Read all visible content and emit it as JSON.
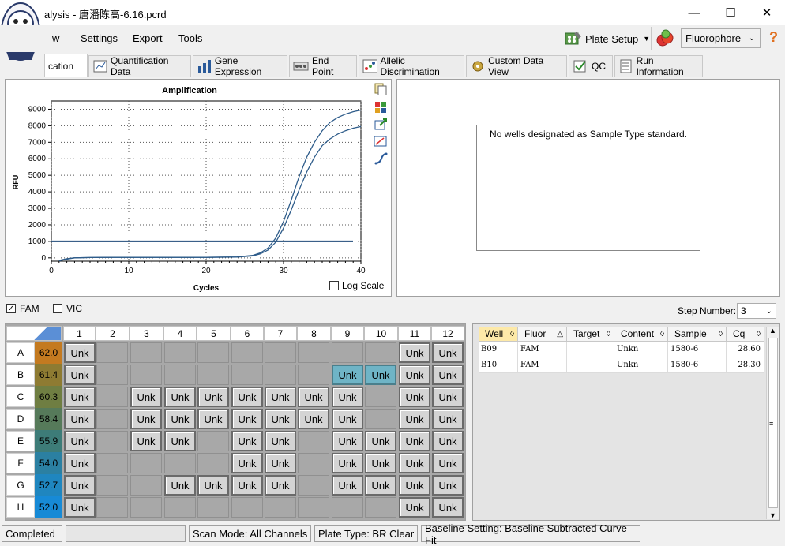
{
  "titlebar": {
    "title": "alysis - 唐潘陈高-6.16.pcrd",
    "minimize": "—",
    "maximize": "☐",
    "close": "✕"
  },
  "menu": {
    "view": "w",
    "settings": "Settings",
    "export": "Export",
    "tools": "Tools",
    "plate_setup": "Plate Setup",
    "fluorophore": "Fluorophore",
    "help": "?"
  },
  "tabs": [
    {
      "label": "cation",
      "icon": "amplification-icon"
    },
    {
      "label": "Quantification Data",
      "icon": "quantification-icon"
    },
    {
      "label": "Gene Expression",
      "icon": "bar-chart-icon"
    },
    {
      "label": "End Point",
      "icon": "endpoint-icon"
    },
    {
      "label": "Allelic Discrimination",
      "icon": "scatter-icon"
    },
    {
      "label": "Custom Data View",
      "icon": "gear-icon"
    },
    {
      "label": "QC",
      "icon": "qc-check-icon"
    },
    {
      "label": "Run Information",
      "icon": "document-icon"
    }
  ],
  "chart_data": {
    "type": "line",
    "title": "Amplification",
    "xlabel": "Cycles",
    "ylabel": "RFU",
    "xlim": [
      0,
      40
    ],
    "ylim": [
      -200,
      9500
    ],
    "xticks": [
      0,
      10,
      20,
      30,
      40
    ],
    "yticks": [
      0,
      1000,
      2000,
      3000,
      4000,
      5000,
      6000,
      7000,
      8000,
      9000
    ],
    "grid": true,
    "threshold": 1000,
    "series": [
      {
        "color": "#2e5c8a",
        "x": [
          1,
          2,
          3,
          5,
          8,
          12,
          16,
          20,
          24,
          26,
          27,
          28,
          29,
          30,
          31,
          32,
          33,
          34,
          35,
          36,
          37,
          38,
          39,
          40
        ],
        "y": [
          -150,
          -50,
          0,
          20,
          30,
          30,
          30,
          30,
          60,
          150,
          300,
          600,
          1200,
          2200,
          3500,
          4900,
          6100,
          7000,
          7700,
          8200,
          8500,
          8700,
          8850,
          8950
        ]
      },
      {
        "color": "#2e5c8a",
        "x": [
          1,
          2,
          3,
          5,
          8,
          12,
          16,
          20,
          24,
          26,
          27,
          28,
          29,
          30,
          31,
          32,
          33,
          34,
          35,
          36,
          37,
          38,
          39,
          40
        ],
        "y": [
          -180,
          -80,
          0,
          20,
          30,
          30,
          30,
          30,
          50,
          120,
          240,
          480,
          950,
          1800,
          2900,
          4100,
          5200,
          6100,
          6800,
          7200,
          7500,
          7700,
          7850,
          7950
        ]
      }
    ],
    "log_scale_label": "Log Scale"
  },
  "standard_curve_message": "No wells designated as Sample Type standard.",
  "filters": {
    "fam": "FAM",
    "vic": "VIC",
    "step_label": "Step Number:",
    "step_value": "3"
  },
  "plate": {
    "columns": [
      "1",
      "2",
      "3",
      "4",
      "5",
      "6",
      "7",
      "8",
      "9",
      "10",
      "11",
      "12"
    ],
    "rows": [
      {
        "row": "A",
        "temp": "62.0",
        "temp_color": "#c47a20",
        "wells": [
          "Unk",
          "",
          "",
          "",
          "",
          "",
          "",
          "",
          "",
          "",
          "Unk",
          "Unk"
        ]
      },
      {
        "row": "B",
        "temp": "61.4",
        "temp_color": "#8e7b32",
        "wells": [
          "Unk",
          "",
          "",
          "",
          "",
          "",
          "",
          "",
          "Unk*",
          "Unk*",
          "Unk",
          "Unk"
        ]
      },
      {
        "row": "C",
        "temp": "60.3",
        "temp_color": "#6f7e42",
        "wells": [
          "Unk",
          "",
          "Unk",
          "Unk",
          "Unk",
          "Unk",
          "Unk",
          "Unk",
          "Unk",
          "",
          "Unk",
          "Unk"
        ]
      },
      {
        "row": "D",
        "temp": "58.4",
        "temp_color": "#567a5a",
        "wells": [
          "Unk",
          "",
          "Unk",
          "Unk",
          "Unk",
          "Unk",
          "Unk",
          "Unk",
          "Unk",
          "",
          "Unk",
          "Unk"
        ]
      },
      {
        "row": "E",
        "temp": "55.9",
        "temp_color": "#3d7c78",
        "wells": [
          "Unk",
          "",
          "Unk",
          "Unk",
          "",
          "Unk",
          "Unk",
          "",
          "Unk",
          "Unk",
          "Unk",
          "Unk"
        ]
      },
      {
        "row": "F",
        "temp": "54.0",
        "temp_color": "#2b80a2",
        "wells": [
          "Unk",
          "",
          "",
          "",
          "",
          "Unk",
          "Unk",
          "",
          "Unk",
          "Unk",
          "Unk",
          "Unk"
        ]
      },
      {
        "row": "G",
        "temp": "52.7",
        "temp_color": "#1f86bf",
        "wells": [
          "Unk",
          "",
          "",
          "Unk",
          "Unk",
          "Unk",
          "Unk",
          "",
          "Unk",
          "Unk",
          "Unk",
          "Unk"
        ]
      },
      {
        "row": "H",
        "temp": "52.0",
        "temp_color": "#178ad6",
        "wells": [
          "Unk",
          "",
          "",
          "",
          "",
          "",
          "",
          "",
          "",
          "",
          "Unk",
          "Unk"
        ]
      }
    ]
  },
  "results_table": {
    "headers": [
      "Well",
      "Fluor",
      "Target",
      "Content",
      "Sample",
      "Cq"
    ],
    "rows": [
      [
        "B09",
        "FAM",
        "",
        "Unkn",
        "1580-6",
        "28.60"
      ],
      [
        "B10",
        "FAM",
        "",
        "Unkn",
        "1580-6",
        "28.30"
      ]
    ]
  },
  "statusbar": {
    "state": "Completed",
    "scan_mode": "Scan Mode: All Channels",
    "plate_type": "Plate Type: BR Clear",
    "baseline": "Baseline Setting: Baseline Subtracted Curve Fit"
  }
}
